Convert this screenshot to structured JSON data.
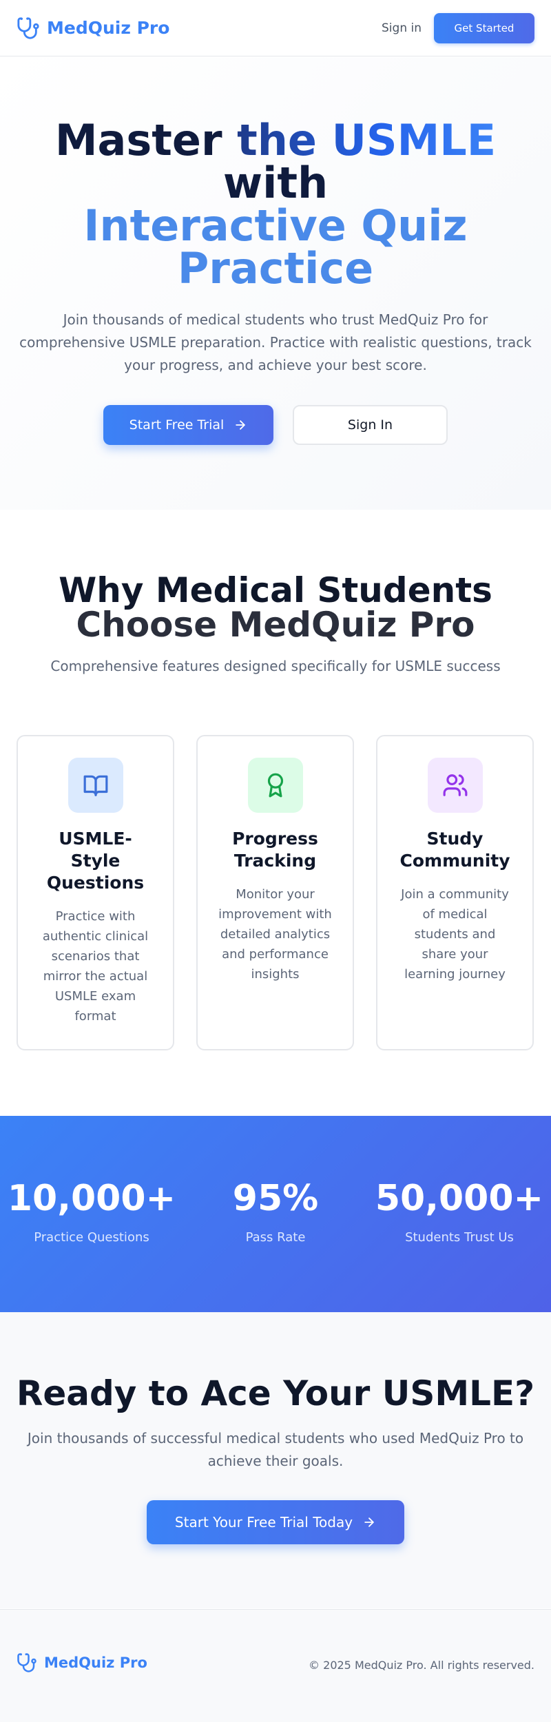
{
  "header": {
    "brand": "MedQuiz Pro",
    "signin_link": "Sign in",
    "cta_button": "Get Started"
  },
  "hero": {
    "title_line1_dark": "Master ",
    "title_line1_grad": "the USMLE",
    "title_line2": "with",
    "title_line3": "Interactive Quiz",
    "title_line4": "Practice",
    "subtitle": "Join thousands of medical students who trust MedQuiz Pro for comprehensive USMLE preparation. Practice with realistic questions, track your progress, and achieve your best score.",
    "primary_button": "Start Free Trial",
    "secondary_button": "Sign In"
  },
  "features": {
    "title_line1": "Why Medical Students",
    "title_line2": "Choose MedQuiz Pro",
    "subtitle": "Comprehensive features designed specifically for USMLE success",
    "cards": [
      {
        "icon": "book-icon",
        "title": "USMLE-Style Questions",
        "description": "Practice with authentic clinical scenarios that mirror the actual USMLE exam format",
        "icon_color": "#3b6fd8",
        "icon_bg": "#dbeafe"
      },
      {
        "icon": "award-icon",
        "title": "Progress Tracking",
        "description": "Monitor your improvement with detailed analytics and performance insights",
        "icon_color": "#16a34a",
        "icon_bg": "#dcfce7"
      },
      {
        "icon": "users-icon",
        "title": "Study Community",
        "description": "Join a community of medical students and share your learning journey",
        "icon_color": "#9333ea",
        "icon_bg": "#f3e8ff"
      }
    ]
  },
  "stats": [
    {
      "value": "10,000+",
      "label": "Practice Questions"
    },
    {
      "value": "95%",
      "label": "Pass Rate"
    },
    {
      "value": "50,000+",
      "label": "Students Trust Us"
    }
  ],
  "cta": {
    "title": "Ready to Ace Your USMLE?",
    "subtitle": "Join thousands of successful medical students who used MedQuiz Pro to achieve their goals.",
    "button": "Start Your Free Trial Today"
  },
  "footer": {
    "brand": "MedQuiz Pro",
    "copyright": "© 2025 MedQuiz Pro. All rights reserved."
  },
  "colors": {
    "primary": "#3b82f6",
    "primary_gradient_end": "#4f6ae8",
    "heading": "#0f172a",
    "body_text": "#5b6577"
  }
}
